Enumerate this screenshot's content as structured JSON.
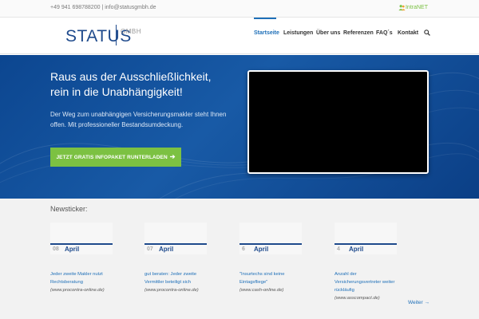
{
  "topbar": {
    "phone": "+49 941 698788200",
    "separator": "|",
    "email": "info@statusgmbh.de",
    "intranet_label": "IntraNET",
    "intranet_icon": "users-icon"
  },
  "header": {
    "logo_text": "STATUS",
    "logo_suffix": "GMBH",
    "nav": [
      {
        "label": "Startseite",
        "active": true
      },
      {
        "label": "Leistungen",
        "active": false
      },
      {
        "label": "Über uns",
        "active": false
      },
      {
        "label": "Referenzen",
        "active": false
      },
      {
        "label": "FAQ´s",
        "active": false
      },
      {
        "label": "Kontakt",
        "active": false
      }
    ],
    "search_icon": "search-icon"
  },
  "hero": {
    "title_line1": "Raus aus der Ausschließlichkeit,",
    "title_line2": "rein in die Unabhängigkeit!",
    "text": "Der Weg zum unabhängigen Versicherungsmakler steht Ihnen offen. Mit professioneller Bestandsumdeckung.",
    "cta_label": "JETZT GRATIS INFOPAKET RUNTERLADEN",
    "cta_icon": "arrow-right-icon"
  },
  "news": {
    "title": "Newsticker:",
    "items": [
      {
        "day": "08",
        "month": "April",
        "headline": "Jeder zweite Makler nutzt Rechtsberatung",
        "source": "(www.procontra-online.de)"
      },
      {
        "day": "07",
        "month": "April",
        "headline": "gut beraten: Jeder zweite Vermittler beteiligt sich",
        "source": "(www.procontra-online.de)"
      },
      {
        "day": "6",
        "month": "April",
        "headline": "\"Insurtechs sind keine Eintagsfliege\"",
        "source": "(www.cash-online.de)"
      },
      {
        "day": "4",
        "month": "April",
        "headline": "Anzahl der Versicherungsvertreter weiter rückläufig",
        "source": "(www.asscompact.de)"
      }
    ],
    "more_label": "Weiter →"
  },
  "colors": {
    "brand_blue": "#1e4a8c",
    "link_blue": "#1e6fb8",
    "cta_green": "#7cc142",
    "hero_blue": "#0c4690"
  }
}
